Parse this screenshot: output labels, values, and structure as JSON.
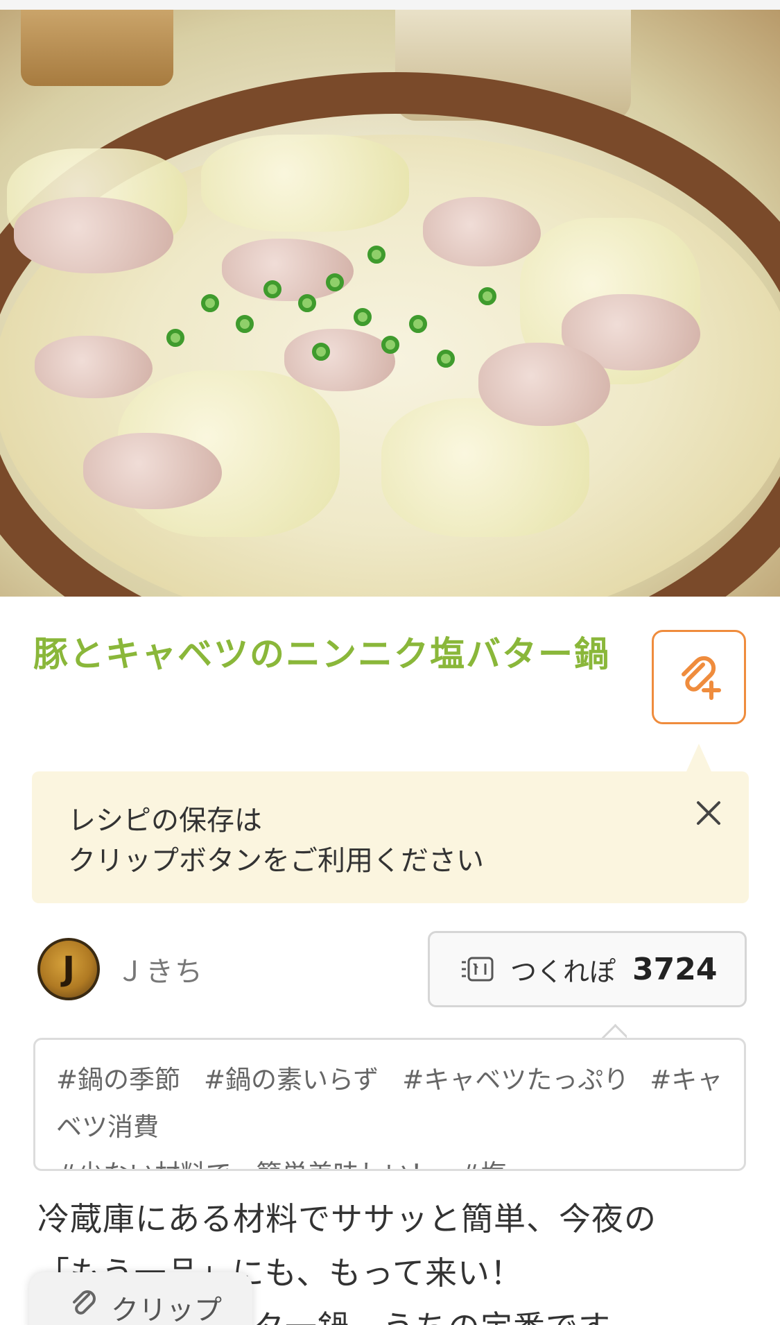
{
  "recipe": {
    "title": "豚とキャベツのニンニク塩バター鍋",
    "clip_icon": "clip-plus-icon"
  },
  "tooltip": {
    "line1": "レシピの保存は",
    "line2": "クリップボタンをご利用ください",
    "close_icon": "close-icon"
  },
  "author": {
    "avatar_letter": "J",
    "name": "Ｊきち"
  },
  "tsukurepo": {
    "icon": "tsukurepo-icon",
    "label": "つくれぽ",
    "count": "3724"
  },
  "tags": [
    "#鍋の季節",
    "#鍋の素いらず",
    "#キャベツたっぷり",
    "#キャベツ消費",
    "#少ない材料で、簡単美味しい！",
    "#塩…"
  ],
  "description": {
    "line1": "冷蔵庫にある材料でササッと簡単、今夜の",
    "line2": "「もう一品」にも、もって来い！",
    "line3": "タ一鍋、うちの定番です。"
  },
  "bottom_bar": {
    "clip_label": "クリップ",
    "clip_icon": "paperclip-icon"
  },
  "colors": {
    "title_green": "#8ab73a",
    "clip_orange": "#ef8c3d",
    "tooltip_bg": "#fbf5df"
  }
}
